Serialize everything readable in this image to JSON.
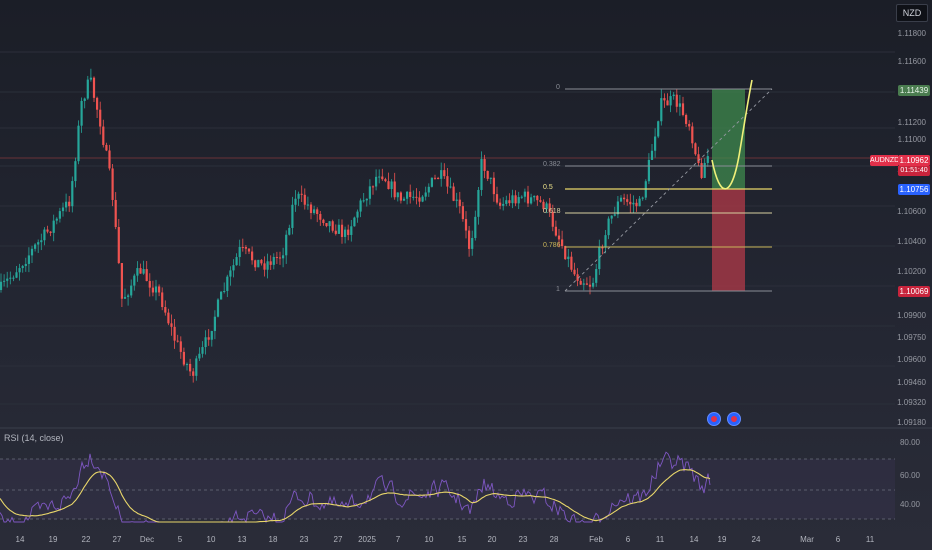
{
  "currency_badge": "NZD",
  "symbol": "AUDNZD",
  "countdown": "01:51:40",
  "price_axis": [
    "1.11800",
    "1.11600",
    "1.11439",
    "1.11200",
    "1.11000",
    "1.10962",
    "1.10800",
    "1.10756",
    "1.10600",
    "1.10400",
    "1.10200",
    "1.10069",
    "1.09900",
    "1.09750",
    "1.09600",
    "1.09460",
    "1.09320",
    "1.09180"
  ],
  "price_tags": {
    "target": "1.11439",
    "current": "1.10962",
    "entry": "1.10756",
    "stop": "1.10069"
  },
  "fib_levels": [
    {
      "label": "0"
    },
    {
      "label": "0.382"
    },
    {
      "label": "0.5"
    },
    {
      "label": "0.618"
    },
    {
      "label": "0.786"
    },
    {
      "label": "1"
    }
  ],
  "rsi": {
    "label": "RSI (14, close)",
    "axis": [
      "80.00",
      "60.00",
      "40.00"
    ]
  },
  "x_axis": [
    "14",
    "19",
    "22",
    "27",
    "Dec",
    "5",
    "10",
    "13",
    "18",
    "23",
    "27",
    "2025",
    "7",
    "10",
    "15",
    "20",
    "23",
    "28",
    "Feb",
    "6",
    "11",
    "14",
    "19",
    "24",
    "Mar",
    "6",
    "11"
  ],
  "colors": {
    "up": "#26a69a",
    "down": "#ef5350",
    "rsi_line": "#7e57c2",
    "rsi_ma": "#e8d66a",
    "fib": "#c9b458",
    "target_zone": "#3f8a4e",
    "stop_zone": "#b23a48"
  }
}
